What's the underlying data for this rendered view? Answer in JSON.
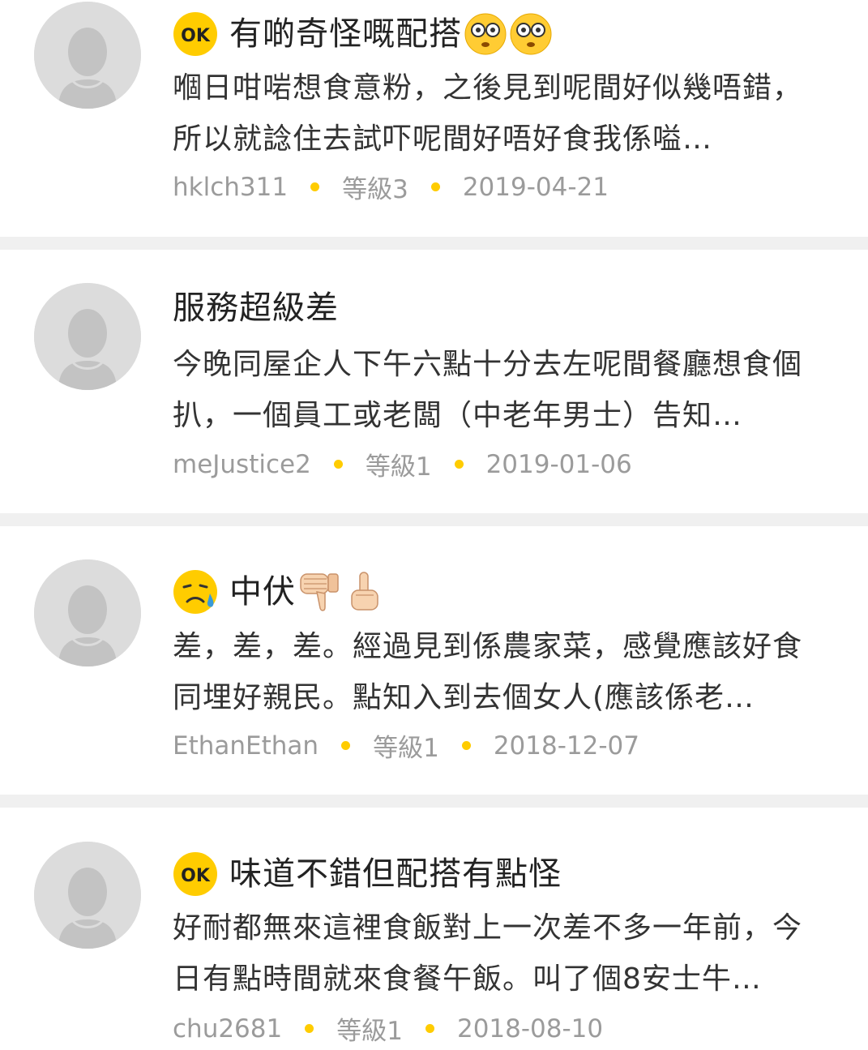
{
  "reviews": [
    {
      "rating": "ok",
      "badge_text": "OK",
      "title": "有啲奇怪嘅配搭",
      "title_emojis": [
        "flushed-face-icon",
        "flushed-face-icon"
      ],
      "body": "嗰日咁啱想食意粉，之後見到呢間好似幾唔錯，所以就諗住去試吓呢間好唔好食我係嗌…",
      "user": "hklch311",
      "level": "等級3",
      "date": "2019-04-21"
    },
    {
      "rating": "none",
      "title": "服務超級差",
      "title_emojis": [],
      "body": "今晚同屋企人下午六點十分去左呢間餐廳想食個扒，一個員工或老闆（中老年男士）告知…",
      "user": "meJustice2",
      "level": "等級1",
      "date": "2019-01-06"
    },
    {
      "rating": "cry",
      "title": "中伏",
      "title_emojis": [
        "thumbs-down-icon",
        "middle-finger-icon"
      ],
      "body": "差，差，差。經過見到係農家菜，感覺應該好食同埋好親民。點知入到去個女人(應該係老…",
      "user": "EthanEthan",
      "level": "等級1",
      "date": "2018-12-07"
    },
    {
      "rating": "ok",
      "badge_text": "OK",
      "title": "味道不錯但配搭有點怪",
      "title_emojis": [],
      "body": "好耐都無來這裡食飯對上一次差不多一年前，今日有點時間就來食餐午飯。叫了個8安士牛…",
      "user": "chu2681",
      "level": "等級1",
      "date": "2018-08-10"
    }
  ],
  "colors": {
    "accent_yellow": "#ffcc00",
    "divider": "#f0f0f0",
    "meta_text": "#9b9b9b",
    "avatar_bg": "#dcdcdc"
  }
}
